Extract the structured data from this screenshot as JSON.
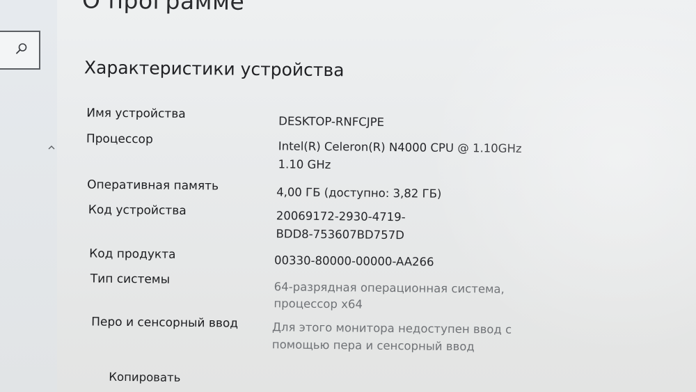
{
  "page_title": "О программе",
  "section_title": "Характеристики устройства",
  "specs": [
    {
      "label": "Имя устройства",
      "value": [
        "DESKTOP-RNFCJPE"
      ]
    },
    {
      "label": "Процессор",
      "value": [
        "Intel(R) Celeron(R) N4000 CPU @ 1.10GHz",
        "1.10 GHz"
      ]
    },
    {
      "label": "Оперативная память",
      "value": [
        "4,00 ГБ (доступно: 3,82 ГБ)"
      ]
    },
    {
      "label": "Код устройства",
      "value": [
        "20069172-2930-4719-",
        "BDD8-753607BD757D"
      ]
    },
    {
      "label": "Код продукта",
      "value": [
        "00330-80000-00000-AA266"
      ]
    },
    {
      "label": "Тип системы",
      "value": [
        "64-разрядная операционная система,",
        "процессор x64"
      ]
    },
    {
      "label": "Перо и сенсорный ввод",
      "value": [
        "Для этого монитора недоступен ввод с",
        "помощью пера и сенсорный ввод"
      ]
    }
  ],
  "copy_label": "Копировать",
  "icons": {
    "search": "search-icon",
    "scroll_up": "chevron-up-icon"
  }
}
